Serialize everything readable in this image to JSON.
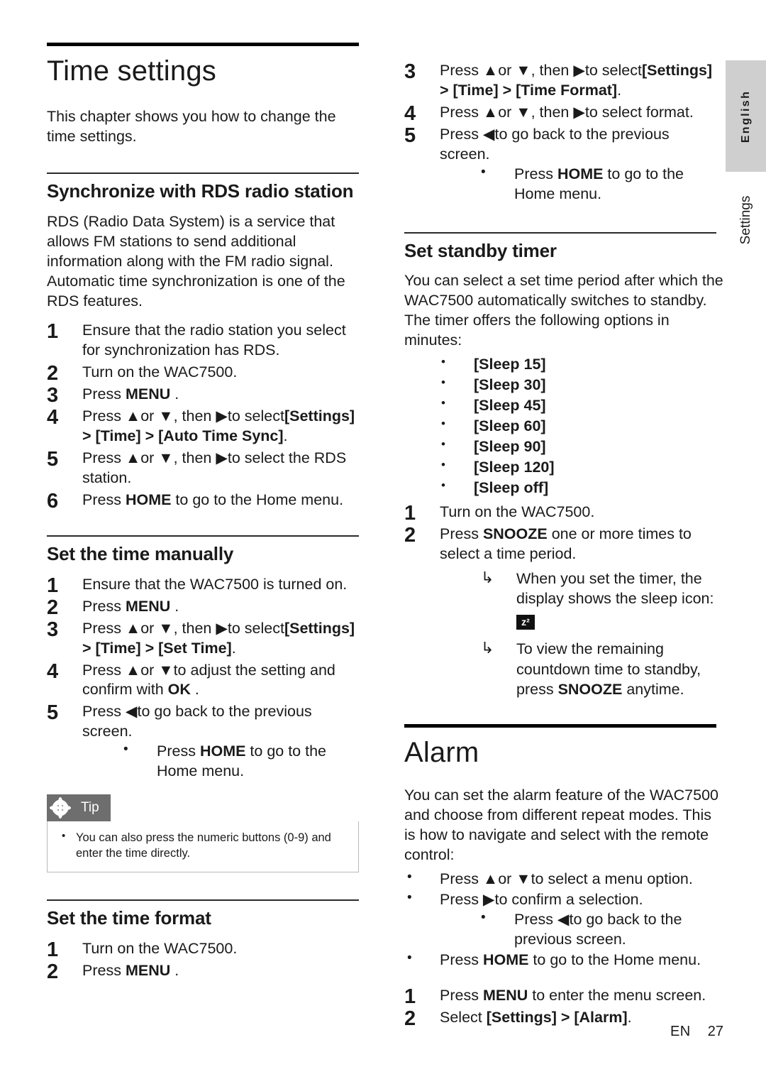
{
  "page": {
    "chapter_title": "Time settings",
    "intro": "This chapter shows you how to change the time settings.",
    "footer_lang": "EN",
    "footer_page": "27",
    "side_tab_language": "English",
    "side_tab_section": "Settings"
  },
  "sections": {
    "rds": {
      "heading": "Synchronize with RDS radio station",
      "intro": "RDS (Radio Data System) is a service that allows FM stations to send additional information along with the FM radio signal. Automatic time synchronization is one of the RDS features.",
      "steps": [
        {
          "num": "1",
          "text": "Ensure that the radio station you select for synchronization has RDS."
        },
        {
          "num": "2",
          "text": "Turn on the WAC7500."
        },
        {
          "num": "3",
          "pre": "Press ",
          "key": "MENU",
          "post": " ."
        },
        {
          "num": "4",
          "pre": "Press ▲or ▼, then ▶to select",
          "bold": "[Settings] > [Time] > [Auto Time Sync]",
          "post": "."
        },
        {
          "num": "5",
          "text": "Press ▲or ▼, then ▶to select the RDS station."
        },
        {
          "num": "6",
          "pre": "Press ",
          "key": "HOME",
          "post": " to go to the Home menu."
        }
      ]
    },
    "manual": {
      "heading": "Set the time manually",
      "steps": [
        {
          "num": "1",
          "text": "Ensure that the WAC7500 is turned on."
        },
        {
          "num": "2",
          "pre": "Press ",
          "key": "MENU",
          "post": " ."
        },
        {
          "num": "3",
          "pre": "Press ▲or ▼, then ▶to select",
          "bold": "[Settings] > [Time] > [Set Time]",
          "post": "."
        },
        {
          "num": "4",
          "pre": "Press ▲or ▼to adjust the setting and confirm with ",
          "key": "OK",
          "post": " ."
        },
        {
          "num": "5",
          "text": "Press ◀to go back to the previous screen."
        }
      ],
      "substep": {
        "pre": "Press ",
        "key": "HOME",
        "post": " to go to the Home menu."
      }
    },
    "tip": {
      "label": "Tip",
      "items": [
        "You can also press the numeric buttons (0-9) and enter the time directly."
      ]
    },
    "format": {
      "heading": "Set the time format",
      "steps_left": [
        {
          "num": "1",
          "text": "Turn on the WAC7500."
        },
        {
          "num": "2",
          "pre": "Press ",
          "key": "MENU",
          "post": " ."
        }
      ],
      "steps_right": [
        {
          "num": "3",
          "pre": "Press ▲or ▼, then ▶to select",
          "bold": "[Settings] > [Time] > [Time Format]",
          "post": "."
        },
        {
          "num": "4",
          "text": "Press ▲or ▼, then ▶to select format."
        },
        {
          "num": "5",
          "text": "Press ◀to go back to the previous screen."
        }
      ],
      "substep": {
        "pre": "Press ",
        "key": "HOME",
        "post": " to go to the Home menu."
      }
    },
    "standby": {
      "heading": "Set standby timer",
      "intro": "You can select a set time period after which the WAC7500 automatically switches to standby. The timer offers the following options in minutes:",
      "options": [
        "[Sleep 15]",
        "[Sleep 30]",
        "[Sleep 45]",
        "[Sleep 60]",
        "[Sleep 90]",
        "[Sleep 120]",
        "[Sleep off]"
      ],
      "steps": [
        {
          "num": "1",
          "text": "Turn on the WAC7500."
        },
        {
          "num": "2",
          "pre": "Press ",
          "key": "SNOOZE",
          "post": "  one or more times to select a time period."
        }
      ],
      "results": [
        {
          "pre": "When you set the timer, the display shows the sleep icon: ",
          "icon": "z²",
          "post": ""
        },
        {
          "pre": "To view the remaining countdown time to standby, press ",
          "key": "SNOOZE",
          "post": "  anytime."
        }
      ]
    },
    "alarm": {
      "heading": "Alarm",
      "intro": "You can set the alarm feature of the WAC7500 and choose from different repeat modes. This is how to navigate and select with the remote control:",
      "bullets": [
        {
          "text": "Press ▲or ▼to select a menu option."
        },
        {
          "text": "Press ▶to confirm a selection."
        }
      ],
      "sub_bullet": {
        "text": "Press ◀to go back to the previous screen."
      },
      "bullet_home": {
        "pre": "Press ",
        "key": "HOME",
        "post": " to go to the Home menu."
      },
      "steps": [
        {
          "num": "1",
          "pre": "Press ",
          "key": "MENU",
          "post": "  to enter the menu screen."
        },
        {
          "num": "2",
          "pre": "Select ",
          "bold": "[Settings] > [Alarm]",
          "post": "."
        }
      ]
    }
  }
}
